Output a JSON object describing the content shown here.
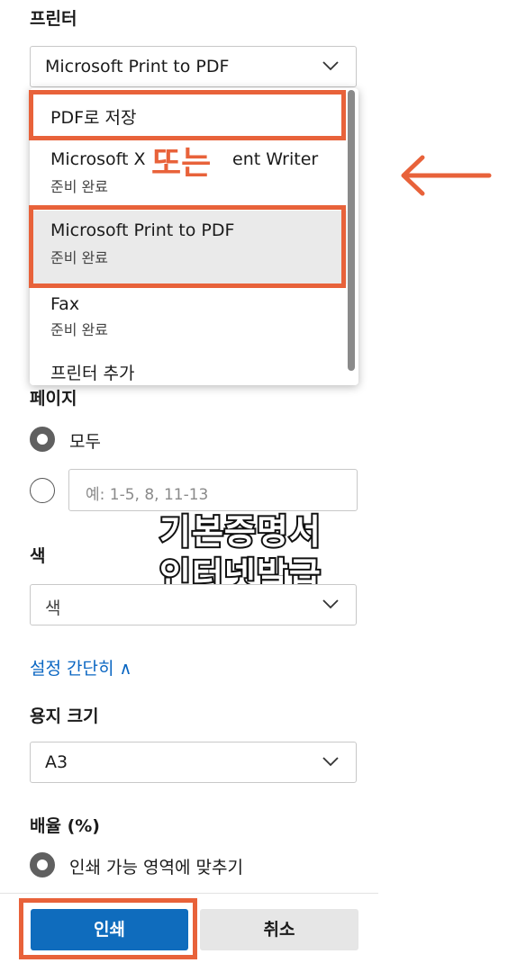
{
  "printer": {
    "heading": "프린터",
    "selected": "Microsoft Print to PDF",
    "menu": [
      {
        "name": "PDF로 저장",
        "status": ""
      },
      {
        "name": "Microsoft X",
        "name_suffix": "ent Writer",
        "status": "준비 완료"
      },
      {
        "name": "Microsoft Print to PDF",
        "status": "준비 완료"
      },
      {
        "name": "Fax",
        "status": "준비 완료"
      },
      {
        "name": "프린터 추가",
        "status": ""
      }
    ],
    "or_label": "또는"
  },
  "pages": {
    "heading": "페이지",
    "all_label": "모두",
    "range_placeholder": "예: 1-5, 8, 11-13"
  },
  "color": {
    "heading": "색",
    "selected": "색"
  },
  "settings_toggle": "설정 간단히 ∧",
  "paper": {
    "heading": "용지 크기",
    "selected": "A3"
  },
  "scale": {
    "heading": "배율 (%)",
    "option": "인쇄 가능 영역에 맞추기"
  },
  "buttons": {
    "print": "인쇄",
    "cancel": "취소"
  },
  "overlay": {
    "line1": "기본증명서",
    "line2": "인터넷발급"
  },
  "colors": {
    "accent": "#e8623a",
    "primary": "#0f6cbd",
    "link": "#0a66c2"
  }
}
